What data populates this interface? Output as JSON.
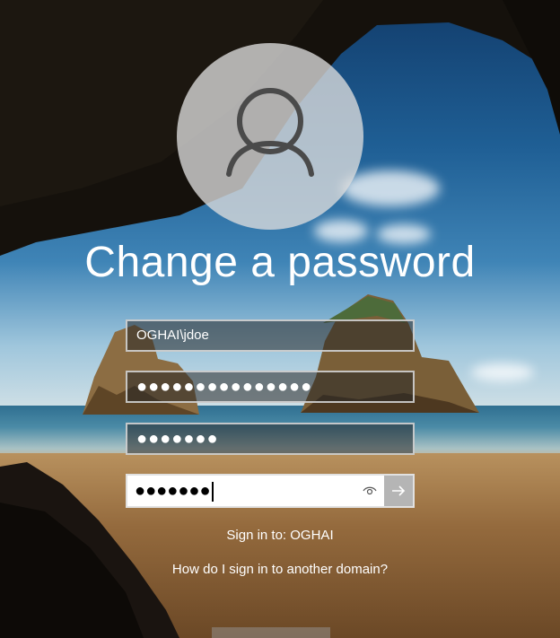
{
  "screen": {
    "title": "Change a password"
  },
  "form": {
    "username_value": "OGHAI\\jdoe",
    "old_password_mask": "●●●●●●●●●●●●●●●",
    "new_password_mask": "●●●●●●●",
    "confirm_password_mask": "●●●●●●●"
  },
  "signin_to": "Sign in to: OGHAI",
  "other_domain_link": "How do I sign in to another domain?",
  "icons": {
    "avatar": "user-silhouette-icon",
    "reveal": "eye-icon",
    "submit": "arrow-right-icon"
  },
  "colors": {
    "text": "#ffffff",
    "field_border": "#dcdcdc",
    "active_field_bg": "#ffffff"
  }
}
